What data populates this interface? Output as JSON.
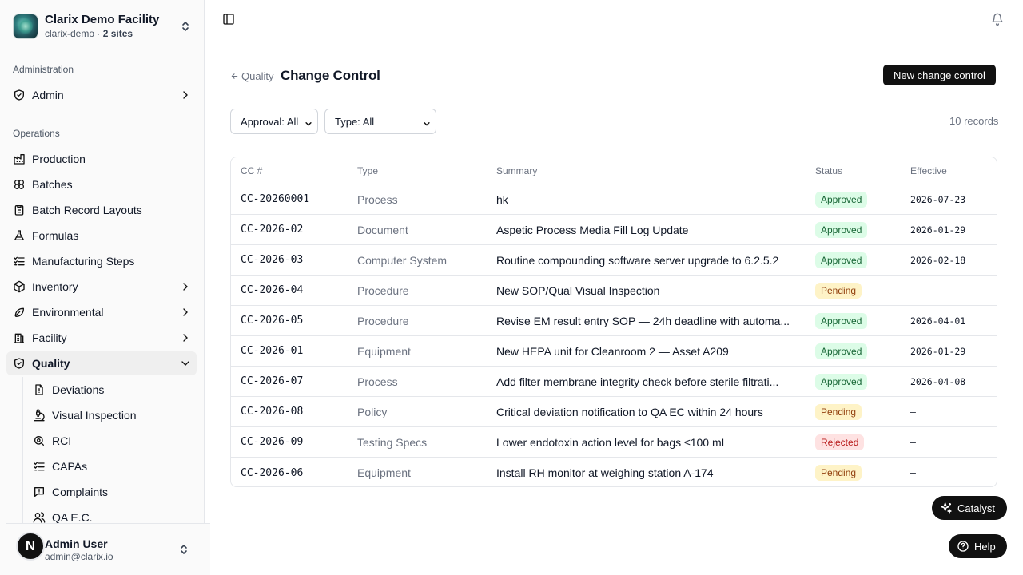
{
  "org": {
    "name": "Clarix Demo Facility",
    "slug": "clarix-demo",
    "separator": " · ",
    "sites": "2 sites"
  },
  "sidebar": {
    "sections": [
      {
        "label": "Administration"
      },
      {
        "label": "Operations"
      }
    ],
    "admin": {
      "label": "Admin",
      "icon": "shield-check-icon"
    },
    "items": [
      {
        "label": "Production",
        "icon": "factory-icon"
      },
      {
        "label": "Batches",
        "icon": "boxes-icon"
      },
      {
        "label": "Batch Record Layouts",
        "icon": "clipboard-icon"
      },
      {
        "label": "Formulas",
        "icon": "flask-icon"
      },
      {
        "label": "Manufacturing Steps",
        "icon": "list-checks-icon"
      },
      {
        "label": "Inventory",
        "icon": "package-icon"
      },
      {
        "label": "Environmental",
        "icon": "leaf-icon"
      },
      {
        "label": "Facility",
        "icon": "building-icon"
      },
      {
        "label": "Quality",
        "icon": "shield-check-icon"
      }
    ],
    "quality_sub": [
      {
        "label": "Deviations",
        "icon": "file-alert-icon"
      },
      {
        "label": "Visual Inspection",
        "icon": "microscope-icon"
      },
      {
        "label": "RCI",
        "icon": "search-icon"
      },
      {
        "label": "CAPAs",
        "icon": "list-checks-icon"
      },
      {
        "label": "Complaints",
        "icon": "message-alert-icon"
      },
      {
        "label": "QA E.C.",
        "icon": "users-icon"
      }
    ]
  },
  "user": {
    "initial": "N",
    "name": "Admin User",
    "email": "admin@clarix.io"
  },
  "page": {
    "breadcrumb": "Quality",
    "title": "Change Control",
    "new_button": "New change control",
    "filters": {
      "approval": "Approval: All",
      "type": "Type: All"
    },
    "records": "10 records"
  },
  "table": {
    "headers": [
      "CC #",
      "Type",
      "Summary",
      "Status",
      "Effective"
    ],
    "rows": [
      {
        "cc": "CC-20260001",
        "type": "Process",
        "summary": "hk",
        "status": "Approved",
        "effective": "2026-07-23"
      },
      {
        "cc": "CC-2026-02",
        "type": "Document",
        "summary": "Aspetic Process Media Fill Log Update",
        "status": "Approved",
        "effective": "2026-01-29"
      },
      {
        "cc": "CC-2026-03",
        "type": "Computer System",
        "summary": "Routine compounding software server upgrade to 6.2.5.2",
        "status": "Approved",
        "effective": "2026-02-18"
      },
      {
        "cc": "CC-2026-04",
        "type": "Procedure",
        "summary": "New SOP/Qual Visual Inspection",
        "status": "Pending",
        "effective": "–"
      },
      {
        "cc": "CC-2026-05",
        "type": "Procedure",
        "summary": "Revise EM result entry SOP — 24h deadline with automa...",
        "status": "Approved",
        "effective": "2026-04-01"
      },
      {
        "cc": "CC-2026-01",
        "type": "Equipment",
        "summary": "New HEPA unit for Cleanroom 2 — Asset A209",
        "status": "Approved",
        "effective": "2026-01-29"
      },
      {
        "cc": "CC-2026-07",
        "type": "Process",
        "summary": "Add filter membrane integrity check before sterile filtrati...",
        "status": "Approved",
        "effective": "2026-04-08"
      },
      {
        "cc": "CC-2026-08",
        "type": "Policy",
        "summary": "Critical deviation notification to QA EC within 24 hours",
        "status": "Pending",
        "effective": "–"
      },
      {
        "cc": "CC-2026-09",
        "type": "Testing Specs",
        "summary": "Lower endotoxin action level for bags ≤100 mL",
        "status": "Rejected",
        "effective": "–"
      },
      {
        "cc": "CC-2026-06",
        "type": "Equipment",
        "summary": "Install RH monitor at weighing station A-174",
        "status": "Pending",
        "effective": "–"
      }
    ]
  },
  "fabs": {
    "catalyst": "Catalyst",
    "help": "Help"
  },
  "colors": {
    "approved": "#dcfce7",
    "pending": "#fef3c7",
    "rejected": "#fee2e2",
    "primary_button": "#111111"
  }
}
